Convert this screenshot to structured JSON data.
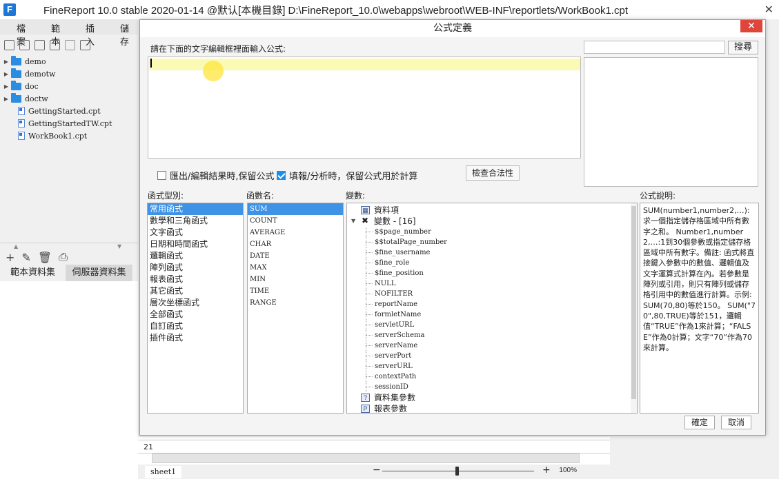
{
  "window": {
    "title": "FineReport 10.0 stable 2020-01-14 @默认[本機目錄]     D:\\FineReport_10.0\\webapps\\webroot\\WEB-INF\\reportlets/WorkBook1.cpt",
    "logo": "F"
  },
  "menu": [
    "檔案",
    "範本",
    "插入",
    "儲存"
  ],
  "tree": {
    "folders": [
      "demo",
      "demotw",
      "doc",
      "doctw"
    ],
    "files": [
      "GettingStarted.cpt",
      "GettingStartedTW.cpt",
      "WorkBook1.cpt"
    ]
  },
  "datasource_tabs": [
    "範本資料集",
    "伺服器資料集"
  ],
  "sheet": {
    "row_number": "21",
    "tab": "sheet1",
    "zoom": "100%"
  },
  "dialog": {
    "title": "公式定義",
    "prompt": "請在下面的文字編輯框裡面輸入公式:",
    "search_button": "搜尋",
    "checkbox1": {
      "label": "匯出/編輯結果時,保留公式",
      "checked": false
    },
    "checkbox2": {
      "label": "填報/分析時，保留公式用於計算",
      "checked": true
    },
    "check_button": "檢查合法性",
    "labels": {
      "category": "函式型別:",
      "function": "函數名:",
      "variable": "變數:",
      "description": "公式說明:"
    },
    "categories": [
      "常用函式",
      "數學和三角函式",
      "文字函式",
      "日期和時間函式",
      "邏輯函式",
      "陣列函式",
      "報表函式",
      "其它函式",
      "層次坐標函式",
      "全部函式",
      "自訂函式",
      "插件函式"
    ],
    "selected_category": 0,
    "functions": [
      "SUM",
      "COUNT",
      "AVERAGE",
      "CHAR",
      "DATE",
      "MAX",
      "MIN",
      "TIME",
      "RANGE"
    ],
    "selected_function": 0,
    "variables": {
      "data_item": "資料項",
      "vars_node": "變數 - [16]",
      "vars": [
        "$$page_number",
        "$$totalPage_number",
        "$fine_username",
        "$fine_role",
        "$fine_position",
        "NULL",
        "NOFILTER",
        "reportName",
        "formletName",
        "servletURL",
        "serverSchema",
        "serverName",
        "serverPort",
        "serverURL",
        "contextPath",
        "sessionID"
      ],
      "dataset_params": "資料集參數",
      "report_params": "報表參數"
    },
    "description": "SUM(number1,number2,…): 求一個指定儲存格區域中所有數字之和。 Number1,number2,…:1到30個參數或指定儲存格區域中所有數字。備註: 函式將直接鍵入參數中的數值、邏輯值及文字運算式計算在內。若參數是陣列或引用，則只有陣列或儲存格引用中的數值進行計算。示例: SUM(70,80)等於150。 SUM(\"70\",80,TRUE)等於151，邏輯值“TRUE”作為1來計算；“FALSE”作為0計算；文字“70”作為70來計算。",
    "ok": "確定",
    "cancel": "取消"
  },
  "colors": {
    "accent": "#3f93e6",
    "close": "#e0453a",
    "editor_line": "#fafab4",
    "folder": "#2b8de2"
  }
}
